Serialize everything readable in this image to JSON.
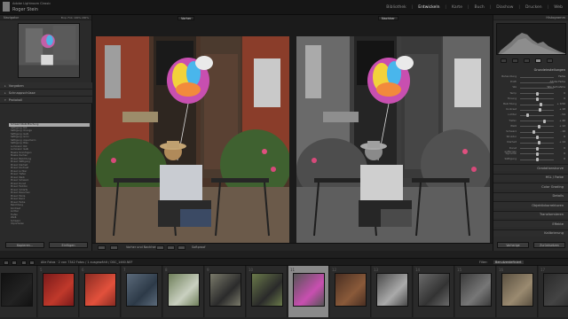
{
  "app": {
    "title": "Adobe Lightroom Classic",
    "user": "Roger Stein"
  },
  "modules": {
    "items": [
      {
        "label": "Bibliothek",
        "active": false
      },
      {
        "label": "Entwickeln",
        "active": true
      },
      {
        "label": "Karte",
        "active": false
      },
      {
        "label": "Buch",
        "active": false
      },
      {
        "label": "Diashow",
        "active": false
      },
      {
        "label": "Drucken",
        "active": false
      },
      {
        "label": "Web",
        "active": false
      }
    ]
  },
  "left_panel": {
    "navigator_title": "Navigator",
    "navigator_zoom": "Einp. Füll. 100% 200%",
    "sections": {
      "presets": "Vorgaben",
      "snapshots": "Schnappschüsse",
      "history": "Protokoll",
      "collections": "Sammlungen"
    },
    "history_items": [
      "Schwarz-Weiß-Mischung",
      "Sättigung: Rot",
      "Sättigung: Orange",
      "Sättigung: Gelb",
      "Sättigung: Grün",
      "Sättigung: Aquamarin",
      "Sättigung: Blau",
      "Luminanz: Rot",
      "Luminanz: Gelb",
      "Maske hinzufügen",
      "Maske löschen",
      "Pinsel: Belichtung",
      "Pinsel: Sättigung",
      "Pinsel: Klarheit",
      "Pinsel: Kontrast",
      "Pinsel: Lichter",
      "Pinsel: Tiefen",
      "Pinsel: Weiß",
      "Pinsel: Schwarz",
      "Pinsel: Dunst",
      "Pinsel: Farbton",
      "Pinsel: Schärfe",
      "Pinsel: Rauschen",
      "Pinsel: Moiré",
      "Pinsel: Rand",
      "Pinsel: Farbe",
      "Belichtung",
      "Kontrast",
      "Lichter",
      "Tiefen",
      "Weiß",
      "Schwarz",
      "Importieren"
    ],
    "buttons": {
      "copy": "Kopieren...",
      "paste": "Einfügen"
    }
  },
  "center": {
    "label_before": "Vorher",
    "label_after": "Nachher",
    "toolbar_text": "Vorher und Nachher:",
    "toolbar_text2": "Softproof"
  },
  "right_panel": {
    "histogram_title": "Histogramm",
    "section_title": "Grundeinstellungen",
    "sliders": [
      {
        "label": "Behandlung",
        "value": "Farbe"
      },
      {
        "label": "Profil",
        "value": "Adobe Farbe"
      },
      {
        "label": "WA",
        "value": "Wie Aufnahme"
      },
      {
        "label": "Temp",
        "value": "0"
      },
      {
        "label": "Tönung",
        "value": "0"
      },
      {
        "label": "Belichtung",
        "value": "+ 0,50"
      },
      {
        "label": "Kontrast",
        "value": "+ 18"
      },
      {
        "label": "Lichter",
        "value": "- 54"
      },
      {
        "label": "Tiefen",
        "value": "+ 46"
      },
      {
        "label": "Weiß",
        "value": "+ 12"
      },
      {
        "label": "Schwarz",
        "value": "- 16"
      },
      {
        "label": "Struktur",
        "value": "0"
      },
      {
        "label": "Klarheit",
        "value": "+ 14"
      },
      {
        "label": "Dunst entfernen",
        "value": "0"
      },
      {
        "label": "Dynamik",
        "value": "0"
      },
      {
        "label": "Sättigung",
        "value": "0"
      }
    ],
    "slider_levels": [
      0,
      0,
      0,
      0.5,
      0.5,
      0.62,
      0.59,
      0.23,
      0.73,
      0.56,
      0.42,
      0.5,
      0.57,
      0.5,
      0.5,
      0.5
    ],
    "sections": [
      "Gradationskurve",
      "HSL / Farbe",
      "Color Grading",
      "Details",
      "Objektivkorrekturen",
      "Transformieren",
      "Effekte",
      "Kalibrierung"
    ],
    "buttons": {
      "previous": "Vorherige",
      "reset": "Zurücksetzen"
    }
  },
  "filmbar": {
    "path_text": "Alle Fotos · 2 von 7342 Fotos / 1 ausgewählt / DSC_1460.NEF",
    "filter_label": "Filter:",
    "filter_value": "Benutzerdefiniert"
  },
  "filmstrip": {
    "numbers": [
      "",
      "5",
      "6",
      "7",
      "8",
      "9",
      "10",
      "11",
      "12",
      "13",
      "14",
      "15",
      "16",
      "17"
    ],
    "selected_index": 7
  },
  "colors": {
    "accent": "#e6e6e6",
    "brick": "#8a3d2a",
    "door": "#3a2a22"
  }
}
